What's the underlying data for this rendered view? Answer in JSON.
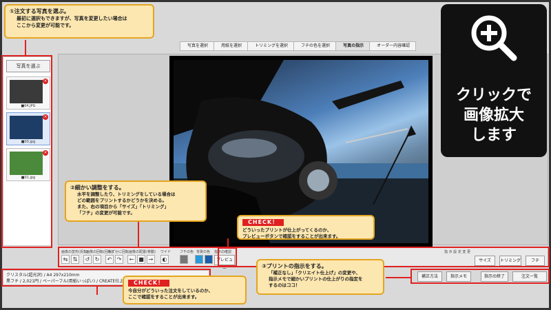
{
  "steps": [
    "写真を選択",
    "用紙を選択",
    "トリミングを選択",
    "フチの色を選択",
    "写真の指示",
    "オーダー内容確認"
  ],
  "left_panel": {
    "select_button": "写真を選ぶ",
    "thumbs": [
      {
        "caption": "■04.JPG",
        "color": "#3a3a3a"
      },
      {
        "caption": "■03.jpg",
        "color": "#1e3d66"
      },
      {
        "caption": "■01.jpg",
        "color": "#4a8a3a"
      }
    ]
  },
  "toolbar": {
    "labels": [
      "画像の変形(反転)",
      "画像の回転(回転)",
      "わずかに回転",
      "画像の配置(移動)",
      "フチの色",
      "背景の色",
      "背景の色2",
      "指示の確認"
    ],
    "labels_short": [
      "ワイド"
    ],
    "preview_button": "プレビュー",
    "right_title": "指 示 設 定 変 更",
    "right_buttons": [
      "サイズ",
      "トリミング",
      "フチ"
    ]
  },
  "footer": {
    "line1": "クリスタル(超光沢) / A4 297x210mm",
    "line2": "黒フチ / 2,021円 / ペーパーフル(用紙いっぱい) / CREATE仕上げ",
    "buttons": [
      "補正方法",
      "指示メモ",
      "指示の終了",
      "注文一覧"
    ]
  },
  "callouts": {
    "c1": {
      "title": "①注文する写真を選ぶ。",
      "body": "最初に選択もできますが、写真を変更したい場合は\nここから変更が可能です。"
    },
    "c2": {
      "title": "②細かい調整をする。",
      "body": "水平を調整したり、トリミングをしている場合は\nどの範囲をプリントするかどうかを決める。\nまた、右の項目から「サイズ」「トリミング」\n「フチ」の変更が可能です。"
    },
    "c3": {
      "tag": "CHECK！",
      "body": "どういったプリントが仕上がってくるのか、\nプレビューボタンで確認をすることが出来ます。"
    },
    "c4": {
      "title": "③プリントの指示をする。",
      "body": "「補正なし」「クリエイト仕上げ」の変更や、\n指示メモで細かいプリントの仕上がりの指定を\nするのはココ！"
    },
    "c5": {
      "tag": "CHECK！",
      "body": "今自分がどういった注文をしているのか、\nここで確認をすることが出来ます。"
    }
  },
  "zoom_badge": {
    "lines": [
      "クリックで",
      "画像拡大",
      "します"
    ]
  }
}
